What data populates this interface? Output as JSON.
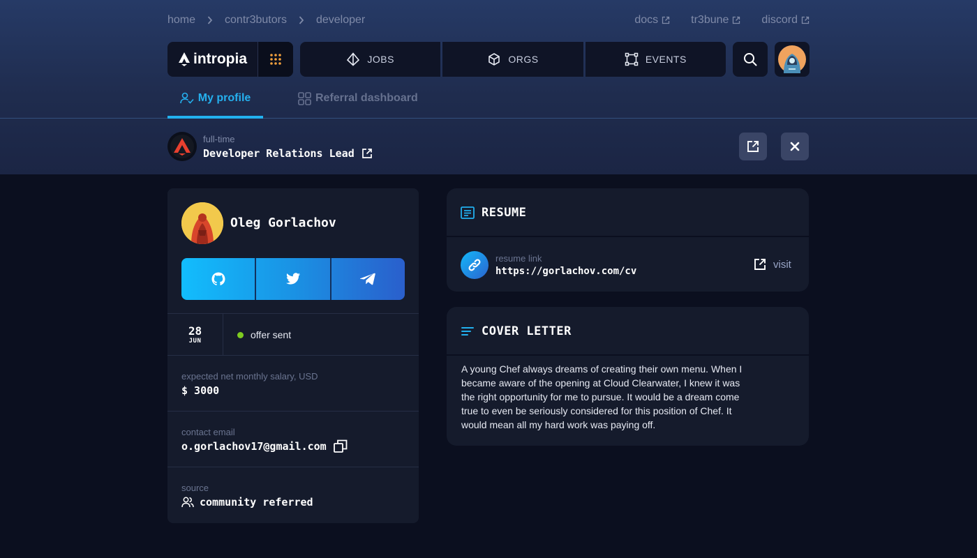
{
  "breadcrumb": [
    "home",
    "contr3butors",
    "developer"
  ],
  "ext_links": [
    "docs",
    "tr3bune",
    "discord"
  ],
  "brand": {
    "name": "intropia"
  },
  "nav": [
    {
      "label": "JOBS",
      "icon": "diamond-icon"
    },
    {
      "label": "ORGS",
      "icon": "cube-icon"
    },
    {
      "label": "EVENTS",
      "icon": "frame-icon"
    }
  ],
  "tabs": {
    "active": "My profile",
    "inactive": "Referral dashboard"
  },
  "job": {
    "type": "full-time",
    "title": "Developer Relations Lead"
  },
  "profile": {
    "name": "Oleg Gorlachov",
    "date_day": "28",
    "date_month": "JUN",
    "status": "offer sent",
    "status_color": "#7ecb20",
    "salary_label": "expected net monthly salary, USD",
    "salary_value": "$ 3000",
    "email_label": "contact email",
    "email_value": "o.gorlachov17@gmail.com",
    "source_label": "source",
    "source_value": "community referred"
  },
  "resume": {
    "title": "RESUME",
    "link_label": "resume link",
    "link_value": "https://gorlachov.com/cv",
    "visit": "visit"
  },
  "cover": {
    "title": "COVER LETTER",
    "text": "A young Chef always dreams of creating their own menu. When I became aware of the opening at Cloud Clearwater, I knew it was the right opportunity for me to pursue. It would be a dream come true to even be seriously considered for this position of Chef. It would mean all my hard work was paying off."
  },
  "colors": {
    "accent": "#22b0ee",
    "brand_gradient_start": "#12bdfd",
    "brand_gradient_end": "#2a5fcc"
  }
}
